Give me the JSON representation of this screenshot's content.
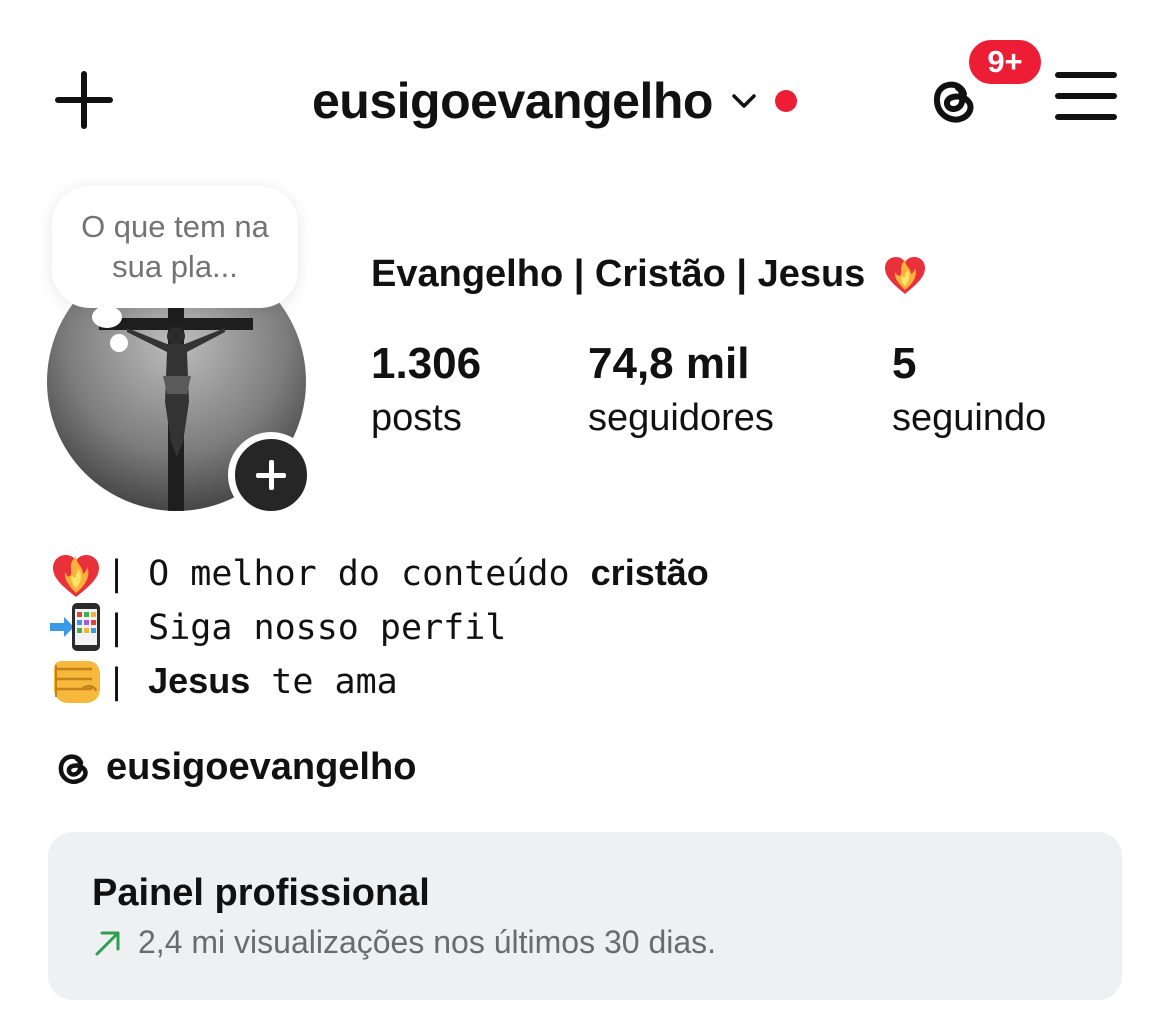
{
  "header": {
    "username": "eusigoevangelho",
    "threads_badge": "9+",
    "icons": [
      "plus-icon",
      "chevron-down-icon",
      "threads-icon",
      "hamburger-menu-icon"
    ]
  },
  "note": {
    "text": "O que tem na sua pla..."
  },
  "profile": {
    "display_name": "Evangelho | Cristão | Jesus",
    "stats": [
      {
        "value": "1.306",
        "label": "posts"
      },
      {
        "value": "74,8 mil",
        "label": "seguidores"
      },
      {
        "value": "5",
        "label": "seguindo"
      }
    ]
  },
  "bio": {
    "lines": [
      {
        "emoji": "heart-on-fire",
        "prefix": "| O melhor do conteúdo ",
        "bold": "cristão",
        "suffix": ""
      },
      {
        "emoji": "mobile-phone-arrow",
        "prefix": "| Siga nosso perfil",
        "bold": "",
        "suffix": ""
      },
      {
        "emoji": "oncoming-fist",
        "prefix": "| ",
        "bold": "Jesus",
        "suffix": " te ama"
      }
    ]
  },
  "threads_link": {
    "handle": "eusigoevangelho"
  },
  "dashboard": {
    "title": "Painel profissional",
    "subtitle": "2,4 mi visualizações nos últimos 30 dias."
  },
  "colors": {
    "badge_red": "#ee1d36",
    "card_bg": "#eff0f2",
    "trend_green": "#2e9e4f",
    "muted_text": "#6b6b6b"
  }
}
